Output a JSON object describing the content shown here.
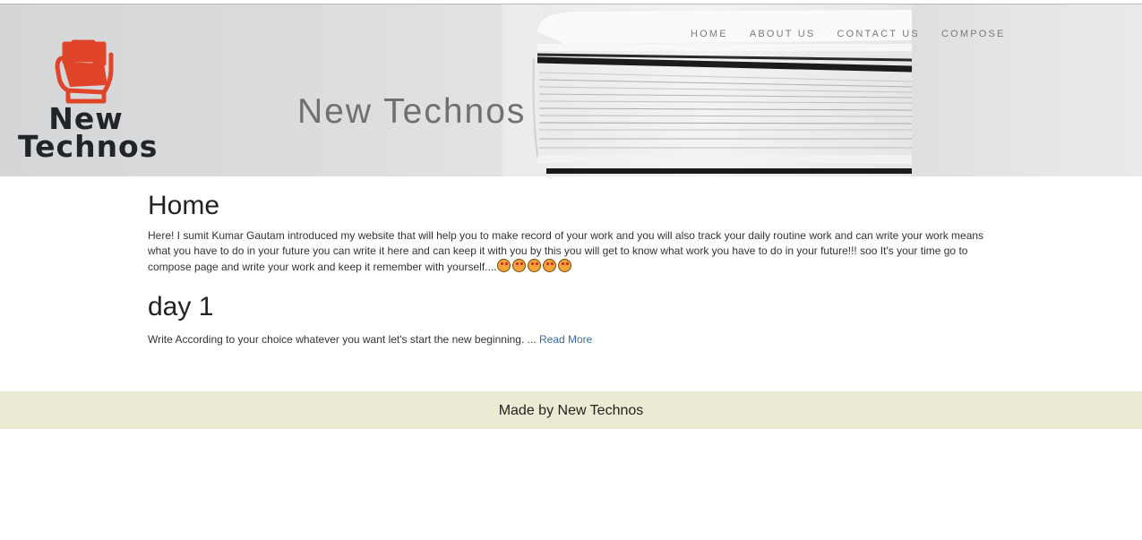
{
  "header": {
    "logo_text_line1": "New",
    "logo_text_line2": "Technos",
    "site_title": "New Technos",
    "nav": [
      "HOME",
      "ABOUT US",
      "CONTACT US",
      "COMPOSE"
    ]
  },
  "main": {
    "heading": "Home",
    "intro": "Here! I sumit Kumar Gautam introduced my website that will help you to make record of your work and you will also track your daily routine work and can write your work means what you have to do in your future you can write it here and can keep it with you by this you will get to know what work you have to do in your future!!! soo It's your time go to compose page and write your work and keep it remember with yourself....",
    "intro_emoji_count": 5,
    "posts": [
      {
        "title": "day 1",
        "excerpt": "Write According to your choice whatever you want let's start the new beginning. ...",
        "read_more": "Read More"
      }
    ]
  },
  "footer": {
    "text": "Made by New Technos"
  },
  "colors": {
    "footer_bg": "#ebebd3",
    "link": "#3a6aa5",
    "logo_fist": "#e0452a"
  }
}
